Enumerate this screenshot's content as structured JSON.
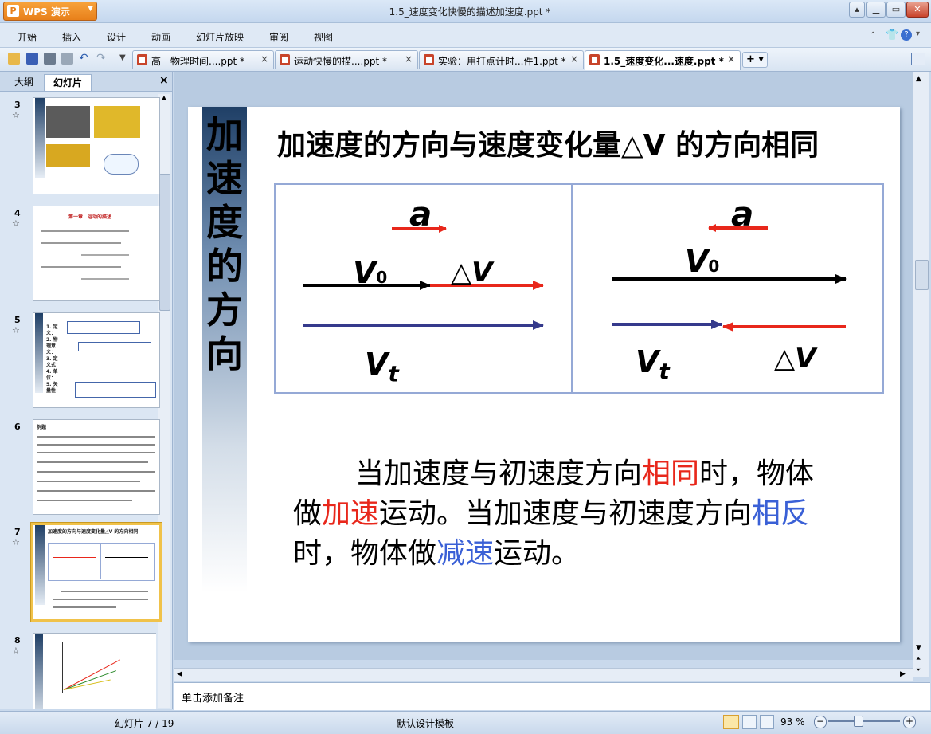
{
  "app": {
    "name": "WPS 演示",
    "window_title": "1.5_速度变化快慢的描述加速度.ppt *"
  },
  "menu": [
    "开始",
    "插入",
    "设计",
    "动画",
    "幻灯片放映",
    "审阅",
    "视图"
  ],
  "doc_tabs": [
    {
      "label": "高一物理时间....ppt *",
      "active": false
    },
    {
      "label": "运动快慢的描....ppt *",
      "active": false
    },
    {
      "label": "实验：用打点计时...件1.ppt *",
      "active": false
    },
    {
      "label": "1.5_速度变化...速度.ppt *",
      "active": true
    }
  ],
  "panel": {
    "tabs": [
      "大纲",
      "幻灯片"
    ],
    "close": "×"
  },
  "thumbnails": [
    {
      "num": "3",
      "text": "",
      "selected": false
    },
    {
      "num": "4",
      "text": "第一章　运动的描述",
      "selected": false
    },
    {
      "num": "5",
      "text": "1. 定义： 2. 物理意义： 3. 定义式： 4. 单位： 5. 矢量性：",
      "selected": false
    },
    {
      "num": "6",
      "text": "例题",
      "selected": false
    },
    {
      "num": "7",
      "text": "加速度的方向与速度变化量△V 的方向相同",
      "selected": true
    },
    {
      "num": "8",
      "text": "",
      "selected": false
    }
  ],
  "slide": {
    "vertical_title": [
      "加",
      "速",
      "度",
      "的",
      "方",
      "向"
    ],
    "heading": "加速度的方向与速度变化量△V 的方向相同",
    "left_diagram": {
      "a": "a",
      "v0": "V",
      "v0_sub": "0",
      "dv": "△V",
      "vt": "V",
      "vt_sub": "t"
    },
    "right_diagram": {
      "a": "a",
      "v0": "V",
      "v0_sub": "0",
      "dv": "△V",
      "vt": "V",
      "vt_sub": "t"
    },
    "body": {
      "p1": "当加速度与初速度方向",
      "same": "相同",
      "p2": "时，物体做",
      "accel": "加速",
      "p3": "运动。当加速度与初速度方向",
      "opposite": "相反",
      "p4": "时，物体做",
      "decel": "减速",
      "p5": "运动。"
    }
  },
  "notes_placeholder": "单击添加备注",
  "status": {
    "slide_count": "幻灯片 7 / 19",
    "template": "默认设计模板",
    "zoom": "93 %"
  },
  "colors": {
    "red_arrow": "#e8271b",
    "black_arrow": "#000000",
    "blue_arrow": "#353a8c",
    "accent_red": "#e8271b",
    "accent_blue": "#3a60d6"
  }
}
